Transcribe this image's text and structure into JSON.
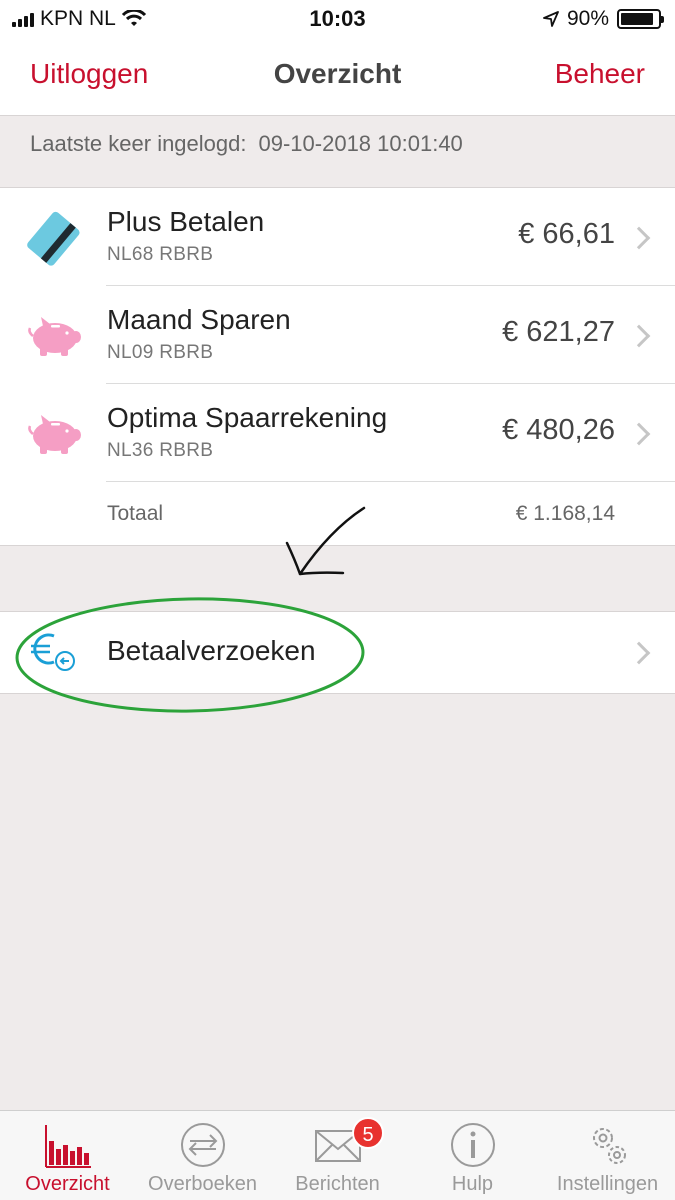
{
  "status_bar": {
    "carrier": "KPN NL",
    "time": "10:03",
    "battery_percent": "90%",
    "battery_level": 0.9
  },
  "nav": {
    "left_label": "Uitloggen",
    "title": "Overzicht",
    "right_label": "Beheer"
  },
  "last_login": {
    "label": "Laatste keer ingelogd:",
    "value": "09-10-2018 10:01:40"
  },
  "accounts": [
    {
      "name": "Plus Betalen",
      "iban": "NL68 RBRB",
      "amount": "€ 66,61",
      "icon": "debit-card-icon"
    },
    {
      "name": "Maand Sparen",
      "iban": "NL09 RBRB",
      "amount": "€ 621,27",
      "icon": "piggy-bank-icon"
    },
    {
      "name": "Optima Spaarrekening",
      "iban": "NL36 RBRB",
      "amount": "€ 480,26",
      "icon": "piggy-bank-icon"
    }
  ],
  "total": {
    "label": "Totaal",
    "value": "€ 1.168,14"
  },
  "payment_requests": {
    "label": "Betaalverzoeken",
    "icon": "euro-request-icon"
  },
  "tabs": [
    {
      "label": "Overzicht",
      "icon": "bar-chart-icon",
      "active": true
    },
    {
      "label": "Overboeken",
      "icon": "transfer-icon",
      "active": false
    },
    {
      "label": "Berichten",
      "icon": "envelope-icon",
      "active": false,
      "badge": "5"
    },
    {
      "label": "Hulp",
      "icon": "info-icon",
      "active": false
    },
    {
      "label": "Instellingen",
      "icon": "gears-icon",
      "active": false
    }
  ],
  "colors": {
    "brand_red": "#c8102e",
    "card_blue": "#6cc9e0",
    "piggy_pink": "#f59ec4",
    "euro_blue": "#1a9fd6",
    "annotation_green": "#2ca33a",
    "badge_red": "#e8322f"
  }
}
